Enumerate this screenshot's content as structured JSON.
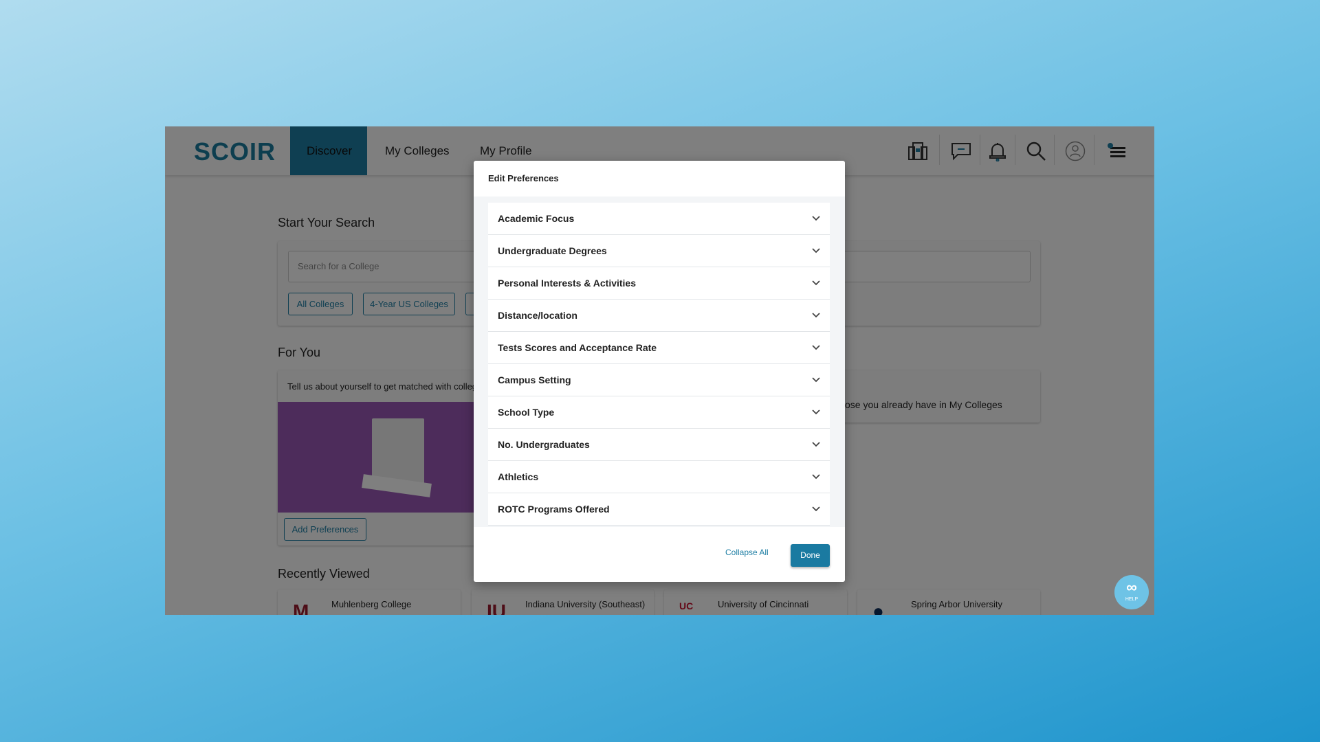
{
  "nav": {
    "logo": "SCOIR",
    "tabs": [
      {
        "label": "Discover",
        "active": true
      },
      {
        "label": "My Colleges"
      },
      {
        "label": "My Profile"
      }
    ],
    "icons": [
      "college-building-icon",
      "chat-icon",
      "bell-icon",
      "search-icon",
      "profile-icon",
      "menu-icon"
    ]
  },
  "search": {
    "title": "Start Your Search",
    "placeholder": "Search for a College",
    "filters": [
      "All Colleges",
      "4-Year US Colleges"
    ]
  },
  "for_you": {
    "title": "For You",
    "card_text": "Tell us about yourself to get matched with colleg",
    "add_button": "Add Preferences",
    "right_card_text": "ose you already have in My Colleges"
  },
  "recent": {
    "title": "Recently Viewed",
    "items": [
      "Muhlenberg College",
      "Indiana University (Southeast)",
      "University of Cincinnati",
      "Spring Arbor University"
    ]
  },
  "modal": {
    "title": "Edit Preferences",
    "sections": [
      "Academic Focus",
      "Undergraduate Degrees",
      "Personal Interests & Activities",
      "Distance/location",
      "Tests Scores and Acceptance Rate",
      "Campus Setting",
      "School Type",
      "No. Undergraduates",
      "Athletics",
      "ROTC Programs Offered"
    ],
    "collapse_all": "Collapse All",
    "done": "Done"
  },
  "help": {
    "label": "HELP"
  },
  "colors": {
    "brand": "#1e7ea4",
    "overlay": "rgba(0,0,0,0.5)"
  }
}
